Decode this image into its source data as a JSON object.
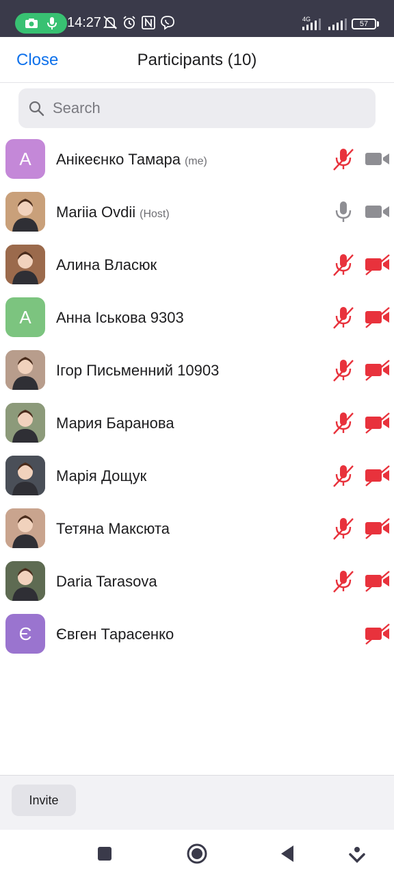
{
  "status_bar": {
    "time": "14:27",
    "network": "4G",
    "battery": "57",
    "icons": [
      "screen-recorder-icon",
      "microphone-icon",
      "mute-notifications-icon",
      "alarm-icon",
      "nfc-icon",
      "viber-icon"
    ]
  },
  "header": {
    "close_label": "Close",
    "title": "Participants (10)"
  },
  "search": {
    "placeholder": "Search"
  },
  "participants": [
    {
      "name": "Анікеєнко Тамара",
      "tag": "(me)",
      "avatar_letter": "А",
      "avatar_color": "#c488d8",
      "mic": "muted",
      "video": "off-gray"
    },
    {
      "name": "Mariia Ovdii",
      "tag": "(Host)",
      "avatar_letter": "",
      "avatar_color": "#c9a07a",
      "mic": "on",
      "video": "off-gray"
    },
    {
      "name": "Алина Власюк",
      "tag": "",
      "avatar_letter": "",
      "avatar_color": "#9b6a4c",
      "mic": "muted",
      "video": "off-red"
    },
    {
      "name": "Анна Іськова 9303",
      "tag": "",
      "avatar_letter": "А",
      "avatar_color": "#7cc47f",
      "mic": "muted",
      "video": "off-red"
    },
    {
      "name": "Ігор Письменний 10903",
      "tag": "",
      "avatar_letter": "",
      "avatar_color": "#b89d8c",
      "mic": "muted",
      "video": "off-red"
    },
    {
      "name": "Мария Баранова",
      "tag": "",
      "avatar_letter": "",
      "avatar_color": "#8c9a7a",
      "mic": "muted",
      "video": "off-red"
    },
    {
      "name": "Марія Дощук",
      "tag": "",
      "avatar_letter": "",
      "avatar_color": "#4a4f58",
      "mic": "muted",
      "video": "off-red"
    },
    {
      "name": "Тетяна Максюта",
      "tag": "",
      "avatar_letter": "",
      "avatar_color": "#c9a48e",
      "mic": "muted",
      "video": "off-red"
    },
    {
      "name": "Daria Tarasova",
      "tag": "",
      "avatar_letter": "",
      "avatar_color": "#5e6b52",
      "mic": "muted",
      "video": "off-red"
    },
    {
      "name": "Євген Тарасенко",
      "tag": "",
      "avatar_letter": "Є",
      "avatar_color": "#9a74cf",
      "mic": "none",
      "video": "off-red"
    }
  ],
  "footer": {
    "invite_label": "Invite"
  },
  "colors": {
    "accent": "#0e71eb",
    "muted_red": "#e8323c",
    "icon_gray": "#8e8e93"
  },
  "nav_icons": [
    "recent-apps-icon",
    "home-icon",
    "back-icon",
    "assistant-icon"
  ]
}
